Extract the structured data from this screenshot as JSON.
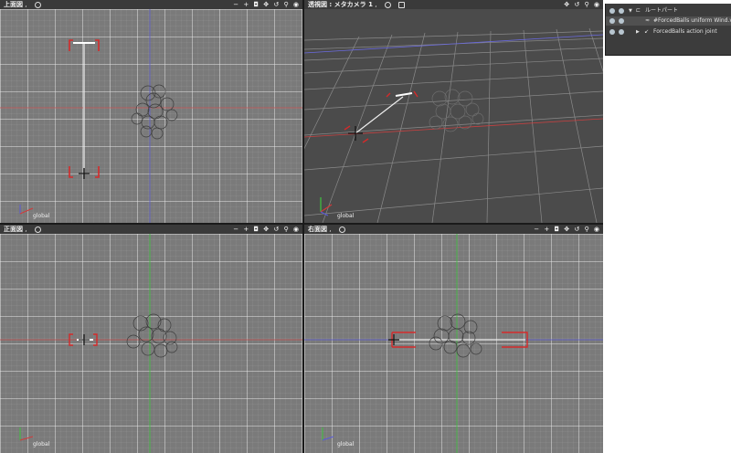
{
  "viewports": {
    "top": {
      "title": "上面図",
      "suffix": " ,",
      "axis_label": "global"
    },
    "perspective": {
      "title": "透視図 : メタカメラ 1",
      "suffix": " ,",
      "axis_label": "global"
    },
    "front": {
      "title": "正面図",
      "suffix": " ,",
      "axis_label": "global"
    },
    "right": {
      "title": "右面図",
      "suffix": " ,",
      "axis_label": "global"
    }
  },
  "toolbar_glyphs": {
    "minus": "−",
    "plus": "+",
    "camera": "◘",
    "move": "✥",
    "rotate": "↺",
    "zoom": "⚲",
    "reset": "◉"
  },
  "scene_tree": {
    "items": [
      {
        "label": "ルートパート"
      },
      {
        "label": "#ForcedBalls uniform Wind.velo"
      },
      {
        "label": "ForcedBalls action joint"
      }
    ]
  },
  "colors": {
    "grid_bg": "#7a7a7a",
    "header_bg": "#3a3a3a",
    "x_axis": "#d23a3a",
    "y_axis": "#3ec43e",
    "z_axis": "#5a5ad8"
  }
}
